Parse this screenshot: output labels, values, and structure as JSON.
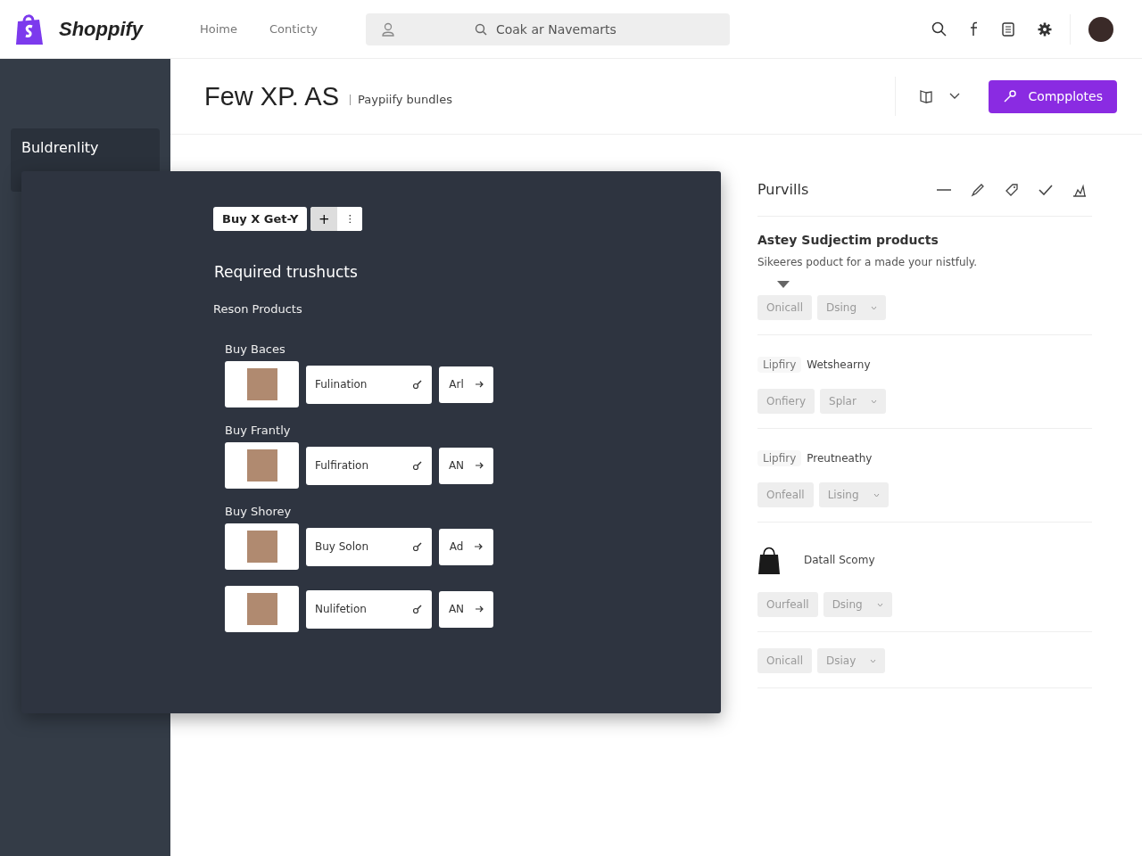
{
  "header": {
    "brand": "Shoppify",
    "nav": [
      {
        "label": "Hoime"
      },
      {
        "label": "Conticty"
      }
    ],
    "search": {
      "placeholder": "Coak ar Navemarts"
    }
  },
  "sidebar": {
    "items": [
      {
        "label": "Buldrenlity",
        "selected": true
      }
    ]
  },
  "page": {
    "title": "Few XP. AS",
    "subtitle": "Paypiify bundles",
    "primary_button": "Compplotes"
  },
  "dialog": {
    "tag": "Buy X Get-Y",
    "plus": "+",
    "more": "⋮",
    "heading": "Required trushucts",
    "subheading": "Reson Products",
    "products": [
      {
        "label": "Buy Baces",
        "field": "Fulination",
        "action": "Arl"
      },
      {
        "label": "Buy Frantly",
        "field": "Fulfiration",
        "action": "AN"
      },
      {
        "label": "Buy Shorey",
        "field": "Buy Solon",
        "action": "Ad"
      },
      {
        "field": "Nulifetion",
        "action": "AN"
      }
    ]
  },
  "panel": {
    "title": "Purvills",
    "sections": [
      {
        "kind": "intro",
        "title": "Astey Sudjectim products",
        "description": "Sikeeres poduct for a made your nistfuly.",
        "chip": "Onicall",
        "select": "Dsing"
      },
      {
        "kind": "tagged",
        "tag": "Lipfiry",
        "name": "Wetshearny",
        "chip": "Onfiery",
        "select": "Splar"
      },
      {
        "kind": "tagged",
        "tag": "Lipfiry",
        "name": "Preutneathy",
        "chip": "Onfeall",
        "select": "Lising"
      },
      {
        "kind": "bag",
        "name": "Datall Scomy",
        "chip": "Ourfeall",
        "select": "Dsing"
      },
      {
        "kind": "plain",
        "chip": "Onicall",
        "select": "Dsiay"
      }
    ]
  }
}
